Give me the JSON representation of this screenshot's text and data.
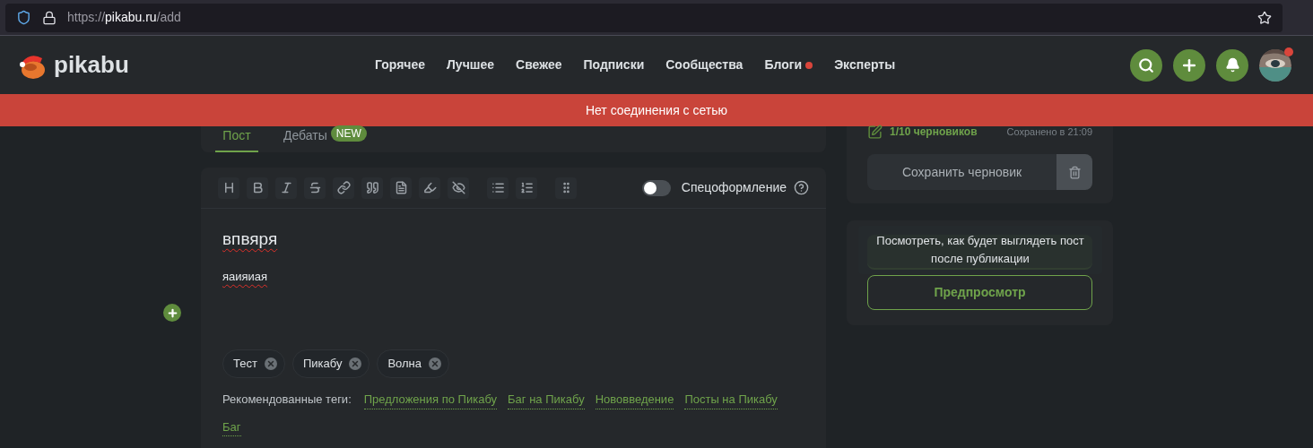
{
  "browser": {
    "scheme": "https://",
    "host": "pikabu.ru",
    "path": "/add"
  },
  "header": {
    "logo": "pikabu",
    "nav": [
      {
        "label": "Горячее",
        "dot": false
      },
      {
        "label": "Лучшее",
        "dot": false
      },
      {
        "label": "Свежее",
        "dot": false
      },
      {
        "label": "Подписки",
        "dot": false
      },
      {
        "label": "Сообщества",
        "dot": false
      },
      {
        "label": "Блоги",
        "dot": true
      },
      {
        "label": "Эксперты",
        "dot": false
      }
    ],
    "avatar_badge": true
  },
  "banner": "Нет соединения с сетью",
  "tabs": [
    {
      "label": "Пост",
      "selected": true
    },
    {
      "label": "Дебаты",
      "badge": "NEW",
      "selected": false
    }
  ],
  "toolbar": {
    "special_format": {
      "label": "Спецоформление",
      "on": false
    }
  },
  "editor": {
    "title": "впвяря",
    "body": "яаияиая",
    "tags": [
      "Тест",
      "Пикабу",
      "Волна"
    ],
    "recommended_label": "Рекомендованные теги:",
    "recommended": [
      "Предложения по Пикабу",
      "Баг на Пикабу",
      "Нововведение",
      "Посты на Пикабу",
      "Баг"
    ]
  },
  "sidebar": {
    "drafts": "1/10 черновиков",
    "saved": "Сохранено в 21:09",
    "save_button": "Сохранить черновик",
    "tooltip": "Посмотреть, как будет выглядеть пост после публикации",
    "preview_button": "Предпросмотр"
  }
}
